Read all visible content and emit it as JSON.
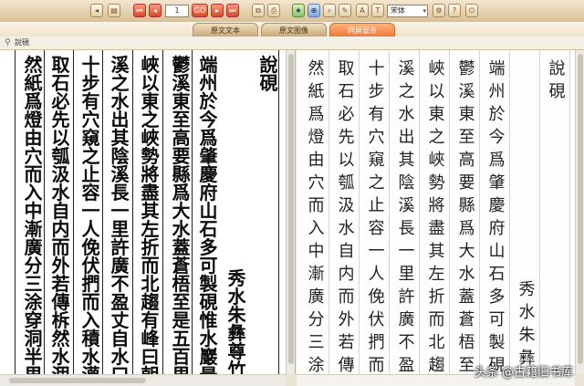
{
  "toolbar": {
    "page_value": "1",
    "go_label": "GO",
    "font_select": "宋体",
    "button_icons": [
      "prev-icon",
      "book-icon",
      "first-page-icon",
      "prev-page-icon",
      "go-icon",
      "next-page-icon",
      "last-page-icon",
      "copy-icon",
      "bookmark-icon",
      "search-icon",
      "zoom-icon",
      "print-icon",
      "font-select",
      "settings-icon",
      "help-icon",
      "exit-icon"
    ]
  },
  "tabs": [
    {
      "label": "原文文本",
      "active": false
    },
    {
      "label": "原文图像",
      "active": false
    },
    {
      "label": "同屏显示",
      "active": true
    }
  ],
  "title": "說硯",
  "scan_columns": [
    "說硯",
    "秀水朱彝尊竹垞",
    "端州於今爲肇慶府山石多可製硯惟水巖最",
    "鬱溪東至高要縣爲大水蓋蒼梧至是五百里",
    "峽以東之峽勢將盡其左折而北趨有峰曰朝",
    "溪之水出其陰溪長一里許廣不盈丈自水口",
    "十步有穴窺之止容一人俛伏捫而入積水灌",
    "取石必先以瓠汲水自内而外若傳柝然水涸",
    "然紙爲燈由穴而入中漸廣分三涂穿洞半里"
  ],
  "text_columns": [
    "說硯",
    "秀水朱彝",
    "端州於今爲肇慶府山石多可製硯",
    "鬱溪東至高要縣爲大水蓋蒼梧至",
    "峽以東之峽勢將盡其左折而北趨",
    "溪之水出其陰溪長一里許廣不盈丈",
    "十步有穴窺之止容一人俛伏捫而入",
    "取石必先以瓠汲水自内而外若傳柝",
    "然紙爲燈由穴而入中漸廣分三涂穿"
  ],
  "watermark": "头条 @古籍旧书库"
}
